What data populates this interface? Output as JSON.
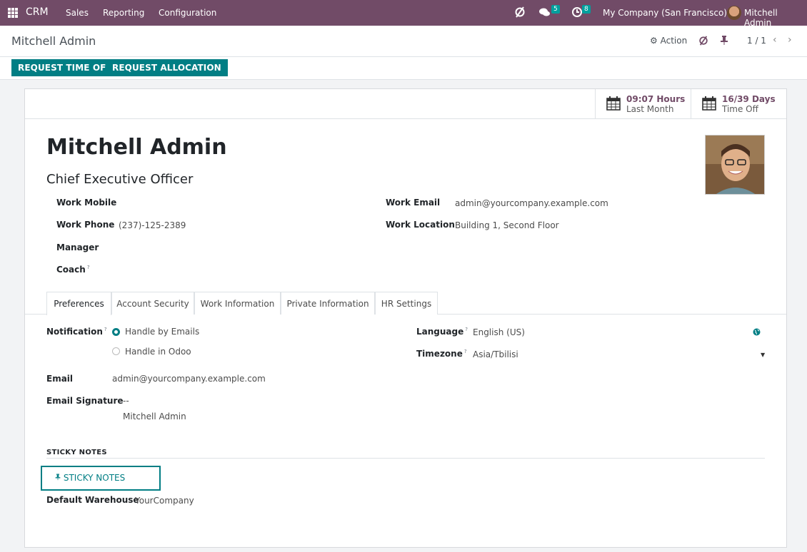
{
  "navbar": {
    "brand": "CRM",
    "menus": [
      "Sales",
      "Reporting",
      "Configuration"
    ],
    "messages_count": "5",
    "activities_count": "8",
    "company": "My Company (San Francisco)",
    "user": "Mitchell Admin"
  },
  "control_panel": {
    "breadcrumb": "Mitchell Admin",
    "action_label": "Action",
    "pager": "1 / 1"
  },
  "statusbar": {
    "request_time_off": "REQUEST TIME OFF",
    "request_allocation": "REQUEST ALLOCATION"
  },
  "stat_buttons": [
    {
      "value": "09:07 Hours",
      "label": "Last Month"
    },
    {
      "value": "16/39 Days",
      "label": "Time Off"
    }
  ],
  "employee": {
    "name": "Mitchell Admin",
    "job_title": "Chief Executive Officer"
  },
  "fields_left": [
    {
      "label": "Work Mobile",
      "value": ""
    },
    {
      "label": "Work Phone",
      "value": "(237)-125-2389"
    },
    {
      "label": "Manager",
      "value": ""
    },
    {
      "label": "Coach",
      "value": ""
    }
  ],
  "fields_right": [
    {
      "label": "Work Email",
      "value": "admin@yourcompany.example.com"
    },
    {
      "label": "Work Location",
      "value": "Building 1, Second Floor"
    }
  ],
  "tabs": [
    "Preferences",
    "Account Security",
    "Work Information",
    "Private Information",
    "HR Settings"
  ],
  "preferences": {
    "notification_label": "Notification",
    "notification_options": [
      "Handle by Emails",
      "Handle in Odoo"
    ],
    "notification_selected": "Handle by Emails",
    "email_label": "Email",
    "email_value": "admin@yourcompany.example.com",
    "signature_label": "Email Signature",
    "signature_sep": "--",
    "signature_value": "Mitchell Admin",
    "language_label": "Language",
    "language_value": "English (US)",
    "timezone_label": "Timezone",
    "timezone_value": "Asia/Tbilisi",
    "sticky_title": "STICKY NOTES",
    "sticky_button": "STICKY NOTES",
    "warehouse_label": "Default Warehouse",
    "warehouse_value": "YourCompany"
  },
  "colors": {
    "brand": "#714b67",
    "accent": "#017e84",
    "badge": "#00a09d"
  }
}
